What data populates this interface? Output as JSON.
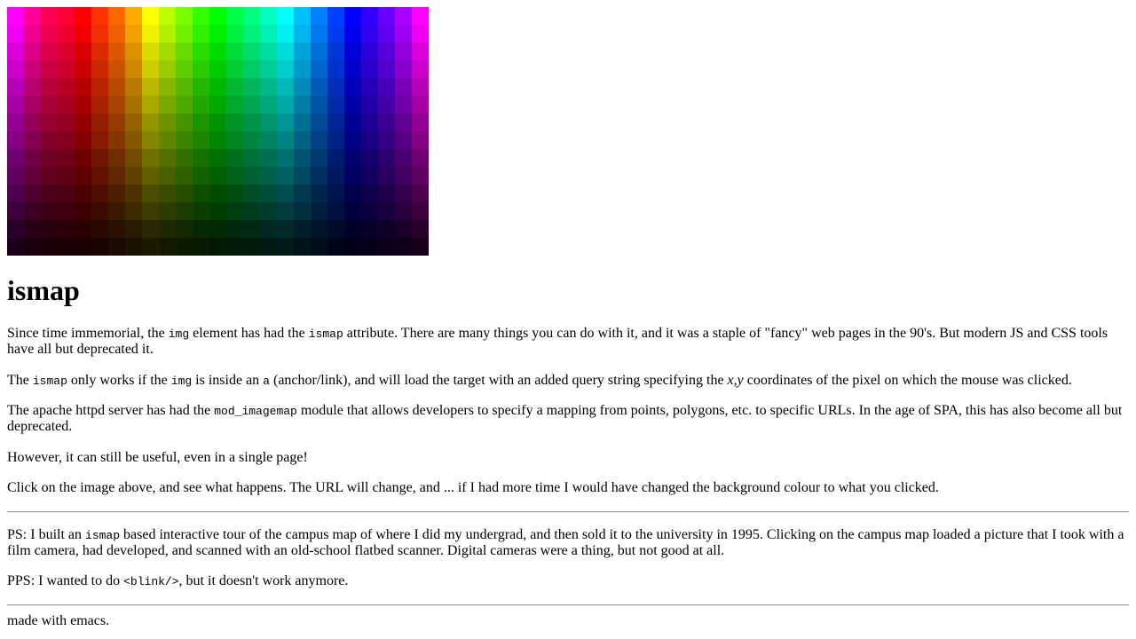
{
  "palette": {
    "hue_columns": 25,
    "brightness_rows": 14,
    "hues_deg": [
      300,
      324,
      340,
      348,
      0,
      12,
      24,
      40,
      60,
      76,
      92,
      108,
      120,
      136,
      150,
      165,
      180,
      195,
      210,
      225,
      240,
      252,
      264,
      280,
      300
    ],
    "brightness_levels": [
      1.0,
      0.93,
      0.86,
      0.79,
      0.72,
      0.65,
      0.58,
      0.51,
      0.44,
      0.37,
      0.3,
      0.23,
      0.16,
      0.09
    ]
  },
  "heading": "ismap",
  "para1": {
    "t1": "Since time immemorial, the ",
    "c1": "img",
    "t2": " element has had the ",
    "c2": "ismap",
    "t3": " attribute. There are many things you can do with it, and it was a staple of \"fancy\" web pages in the 90's. But modern JS and CSS tools have all but deprecated it."
  },
  "para2": {
    "t1": "The ",
    "c1": "ismap",
    "t2": " only works if the ",
    "c2": "img",
    "t3": " is inside an ",
    "c3": "a",
    "t4": " (anchor/link), and will load the target with an added query string specifying the ",
    "em1": "x,y",
    "t5": " coordinates of the pixel on which the mouse was clicked."
  },
  "para3": {
    "t1": "The apache httpd server has had the ",
    "c1": "mod_imagemap",
    "t2": " module that allows developers to specify a mapping from points, polygons, etc. to specific URLs. In the age of SPA, this has also become all but deprecated."
  },
  "para4": "However, it can still be useful, even in a single page!",
  "para5": "Click on the image above, and see what happens. The URL will change, and ... if I had more time I would have changed the background colour to what you clicked.",
  "ps1": {
    "t1": "PS: I built an ",
    "c1": "ismap",
    "t2": " based interactive tour of the campus map of where I did my undergrad, and then sold it to the university in 1995. Clicking on the campus map loaded a picture that I took with a film camera, had developed, and scanned with an old-school flatbed scanner. Digital cameras were a thing, but not good at all."
  },
  "ps2": {
    "t1": "PPS: I wanted to do ",
    "c1": "<blink/>",
    "t2": ", but it doesn't work anymore."
  },
  "footer": "made with emacs."
}
